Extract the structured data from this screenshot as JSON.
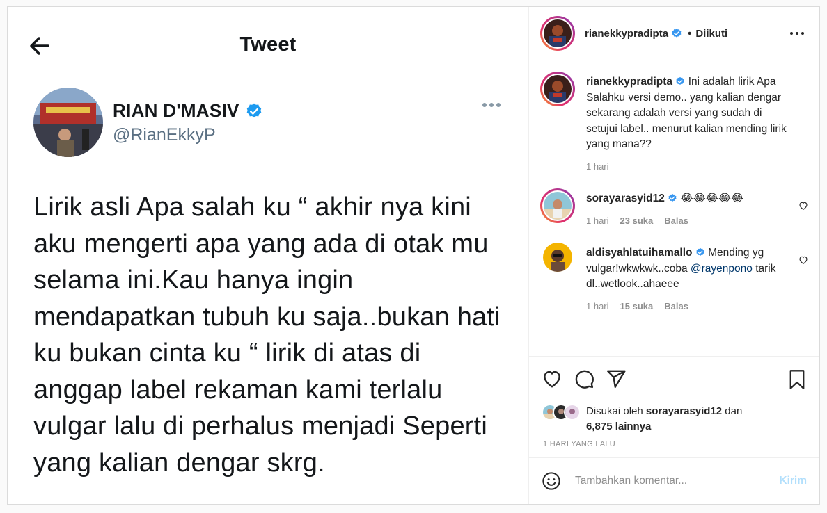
{
  "tweet": {
    "title": "Tweet",
    "name": "RIAN D'MASIV",
    "handle": "@RianEkkyP",
    "text": "Lirik asli Apa salah ku “ akhir nya kini aku mengerti apa yang ada di otak mu selama ini.Kau hanya ingin mendapatkan tubuh ku saja..bukan hati ku bukan cinta ku “ lirik di atas di anggap label rekaman kami terlalu vulgar lalu di perhalus menjadi Seperti yang kalian dengar skrg."
  },
  "header": {
    "username": "rianekkypradipta",
    "separator": "•",
    "follow_status": "Diikuti"
  },
  "caption": {
    "username": "rianekkypradipta",
    "text": "Ini adalah lirik Apa Salahku versi demo.. yang kalian dengar sekarang adalah versi yang sudah di setujui label.. menurut kalian mending lirik yang mana??",
    "time": "1 hari"
  },
  "comments": [
    {
      "username": "sorayarasyid12",
      "text": "😂😂😂😂😂",
      "time": "1 hari",
      "likes": "23 suka",
      "reply": "Balas"
    },
    {
      "username": "aldisyahlatuihamallo",
      "text_before": "Mending yg vulgar!wkwkwk..coba ",
      "mention": "@rayenpono",
      "text_after": " tarik dl..wetlook..ahaeee",
      "time": "1 hari",
      "likes": "15 suka",
      "reply": "Balas"
    }
  ],
  "likes": {
    "prefix": "Disukai oleh ",
    "user": "sorayarasyid12",
    "middle": " dan",
    "others": "6,875 lainnya"
  },
  "timestamp": "1 HARI YANG LALU",
  "add_comment": {
    "placeholder": "Tambahkan komentar...",
    "post_label": "Kirim"
  },
  "colors": {
    "verified": "#3897f0",
    "post_button_disabled": "#b2dffc",
    "mention": "#00376b"
  }
}
